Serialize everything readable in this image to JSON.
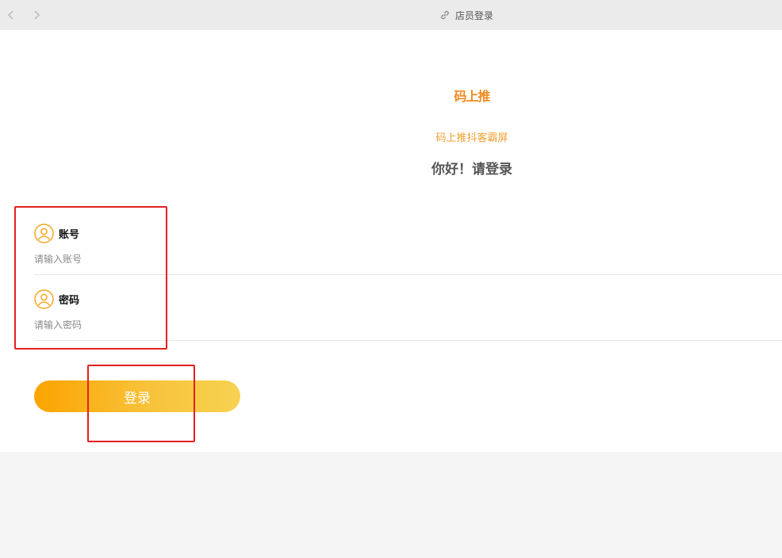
{
  "topbar": {
    "title": "店员登录",
    "back_icon": "chevron-left-icon",
    "forward_icon": "chevron-right-icon",
    "link_icon": "link-icon"
  },
  "brand": {
    "logo_text": "码上推",
    "subtitle": "码上推抖客霸屏",
    "greeting": "你好！请登录"
  },
  "form": {
    "account": {
      "label": "账号",
      "placeholder": "请输入账号",
      "value": "",
      "icon": "user-icon"
    },
    "password": {
      "label": "密码",
      "placeholder": "请输入密码",
      "value": "",
      "icon": "user-icon"
    },
    "login_label": "登录"
  },
  "colors": {
    "brand_orange": "#f08a1c",
    "accent_gold": "#f0a030",
    "button_gradient_start": "#fba400",
    "button_gradient_end": "#f7d252",
    "annotation_red": "#e32020"
  }
}
